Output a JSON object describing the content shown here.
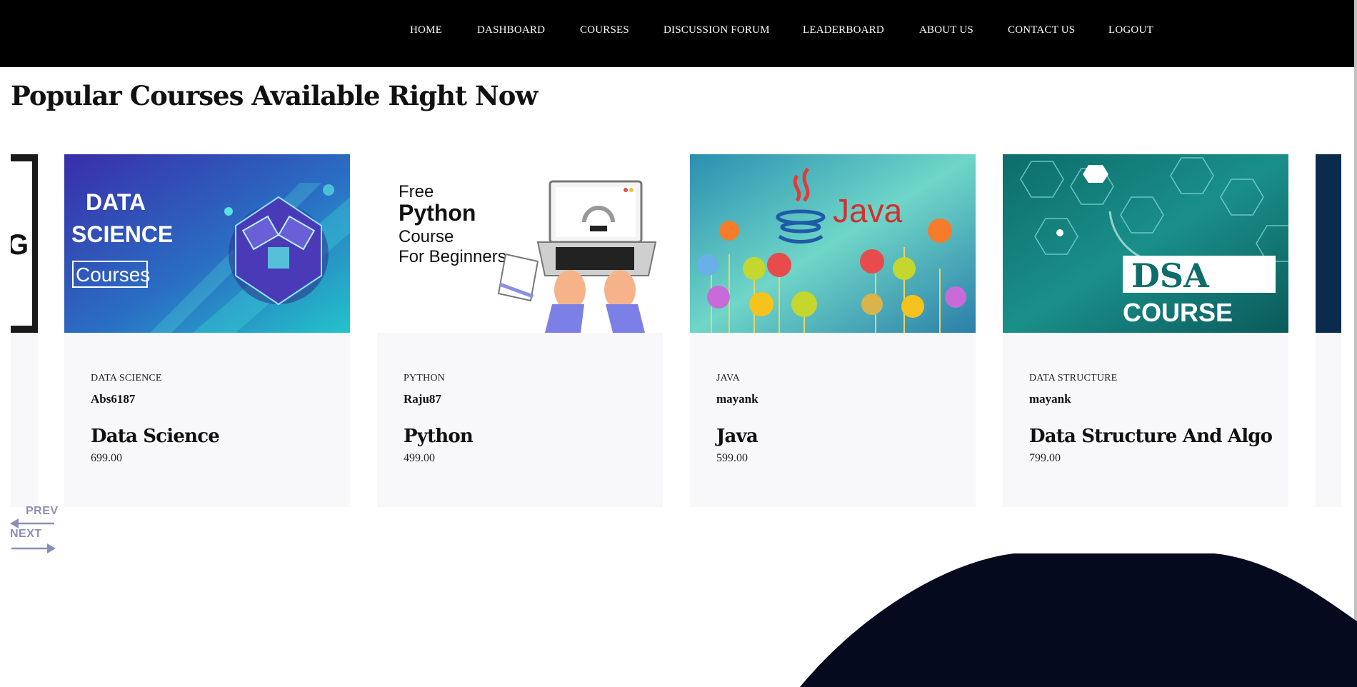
{
  "nav": {
    "items": [
      "HOME",
      "DASHBOARD",
      "COURSES",
      "DISCUSSION FORUM",
      "LEADERBOARD",
      "ABOUT US",
      "CONTACT US",
      "LOGOUT"
    ]
  },
  "section": {
    "title": "Popular Courses Available Right Now"
  },
  "courses": [
    {
      "category": "DATA SCIENCE",
      "author": "Abs6187",
      "title": "Data Science",
      "price": "699.00",
      "image": {
        "line1": "DATA",
        "line2": "SCIENCE",
        "line3": "Courses"
      }
    },
    {
      "category": "PYTHON",
      "author": "Raju87",
      "title": "Python",
      "price": "499.00",
      "image": {
        "line1": "Free",
        "line2": "Python",
        "line3": "Course",
        "line4": "For Beginners"
      }
    },
    {
      "category": "JAVA",
      "author": "mayank",
      "title": "Java",
      "price": "599.00",
      "image": {
        "line1": "Java"
      }
    },
    {
      "category": "DATA STRUCTURE",
      "author": "mayank",
      "title": "Data Structure And Algo",
      "price": "799.00",
      "image": {
        "line1": "DSA",
        "line2": "COURSE"
      }
    }
  ],
  "carousel": {
    "prev_label": "PREV",
    "next_label": "NEXT"
  },
  "colors": {
    "nav_bg": "#000000",
    "card_bg": "#f8f8fa",
    "control": "#8b8fb8",
    "blob": "#050a1e"
  }
}
